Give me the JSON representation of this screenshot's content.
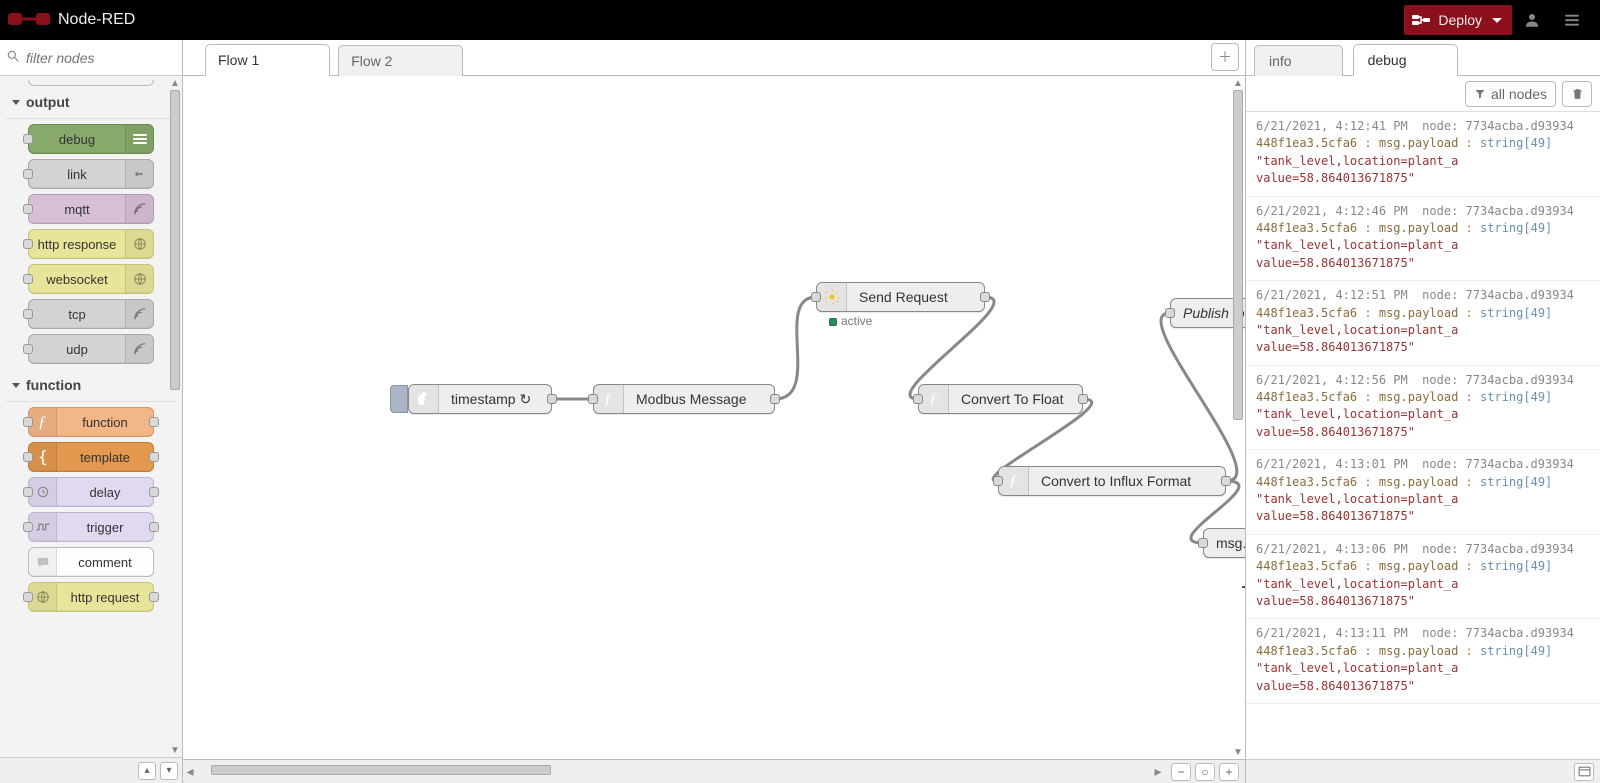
{
  "app": {
    "name": "Node-RED",
    "deploy_label": "Deploy"
  },
  "palette": {
    "filter_placeholder": "filter nodes",
    "categories": [
      {
        "name": "output",
        "nodes": [
          {
            "label": "debug",
            "color": "c-green",
            "icon": "stripes",
            "icon_side": "right",
            "ports": "left"
          },
          {
            "label": "link",
            "color": "c-grey",
            "icon": "link-out",
            "icon_side": "right",
            "ports": "left"
          },
          {
            "label": "mqtt",
            "color": "c-purple",
            "icon": "waves",
            "icon_side": "right",
            "ports": "left"
          },
          {
            "label": "http response",
            "color": "c-yellow",
            "icon": "globe",
            "icon_side": "right",
            "ports": "left"
          },
          {
            "label": "websocket",
            "color": "c-yellow",
            "icon": "globe",
            "icon_side": "right",
            "ports": "left"
          },
          {
            "label": "tcp",
            "color": "c-grey",
            "icon": "waves",
            "icon_side": "right",
            "ports": "left"
          },
          {
            "label": "udp",
            "color": "c-grey",
            "icon": "waves",
            "icon_side": "right",
            "ports": "left"
          }
        ]
      },
      {
        "name": "function",
        "nodes": [
          {
            "label": "function",
            "color": "c-orange",
            "icon": "fx",
            "icon_side": "left",
            "ports": "both"
          },
          {
            "label": "template",
            "color": "c-darkor",
            "icon": "brace",
            "icon_side": "left",
            "ports": "both"
          },
          {
            "label": "delay",
            "color": "c-lav",
            "icon": "clock",
            "icon_side": "left",
            "ports": "both"
          },
          {
            "label": "trigger",
            "color": "c-lav",
            "icon": "pulse",
            "icon_side": "left",
            "ports": "both"
          },
          {
            "label": "comment",
            "color": "c-white",
            "icon": "comment",
            "icon_side": "left",
            "ports": "none"
          },
          {
            "label": "http request",
            "color": "c-yellow",
            "icon": "globe",
            "icon_side": "left",
            "ports": "both"
          }
        ]
      }
    ]
  },
  "workspace": {
    "tabs": [
      {
        "label": "Flow 1"
      },
      {
        "label": "Flow 2"
      }
    ],
    "active_tab": 0,
    "nodes": {
      "inject": {
        "label": "timestamp ↻",
        "status": ""
      },
      "modbus": {
        "label": "Modbus Message"
      },
      "request": {
        "label": "Send Request",
        "status_label": "active"
      },
      "tofloat": {
        "label": "Convert To Float"
      },
      "toinflux": {
        "label": "Convert to Influx Format"
      },
      "mqttout": {
        "label": "Publish to HiveMQ Broker"
      },
      "debug": {
        "label": "msg.payload"
      }
    },
    "cursor": "+"
  },
  "sidebar": {
    "tabs": [
      {
        "label": "info"
      },
      {
        "label": "debug"
      }
    ],
    "active_tab": 1,
    "filter_label": "all nodes",
    "messages": [
      {
        "time": "6/21/2021, 4:12:41 PM",
        "node": "7734acba.d93934",
        "src": "448f1ea3.5cfa6",
        "prop": "msg.payload",
        "type": "string[49]",
        "payload": "\"tank_level,location=plant_a value=58.864013671875\""
      },
      {
        "time": "6/21/2021, 4:12:46 PM",
        "node": "7734acba.d93934",
        "src": "448f1ea3.5cfa6",
        "prop": "msg.payload",
        "type": "string[49]",
        "payload": "\"tank_level,location=plant_a value=58.864013671875\""
      },
      {
        "time": "6/21/2021, 4:12:51 PM",
        "node": "7734acba.d93934",
        "src": "448f1ea3.5cfa6",
        "prop": "msg.payload",
        "type": "string[49]",
        "payload": "\"tank_level,location=plant_a value=58.864013671875\""
      },
      {
        "time": "6/21/2021, 4:12:56 PM",
        "node": "7734acba.d93934",
        "src": "448f1ea3.5cfa6",
        "prop": "msg.payload",
        "type": "string[49]",
        "payload": "\"tank_level,location=plant_a value=58.864013671875\""
      },
      {
        "time": "6/21/2021, 4:13:01 PM",
        "node": "7734acba.d93934",
        "src": "448f1ea3.5cfa6",
        "prop": "msg.payload",
        "type": "string[49]",
        "payload": "\"tank_level,location=plant_a value=58.864013671875\""
      },
      {
        "time": "6/21/2021, 4:13:06 PM",
        "node": "7734acba.d93934",
        "src": "448f1ea3.5cfa6",
        "prop": "msg.payload",
        "type": "string[49]",
        "payload": "\"tank_level,location=plant_a value=58.864013671875\""
      },
      {
        "time": "6/21/2021, 4:13:11 PM",
        "node": "7734acba.d93934",
        "src": "448f1ea3.5cfa6",
        "prop": "msg.payload",
        "type": "string[49]",
        "payload": "\"tank_level,location=plant_a value=58.864013671875\""
      }
    ]
  }
}
